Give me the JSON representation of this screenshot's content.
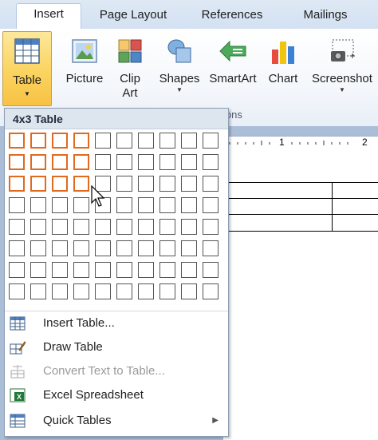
{
  "tabs": [
    {
      "label": "Insert",
      "active": true
    },
    {
      "label": "Page Layout",
      "active": false
    },
    {
      "label": "References",
      "active": false
    },
    {
      "label": "Mailings",
      "active": false
    }
  ],
  "ribbon": {
    "table_button": "Table",
    "picture_button": "Picture",
    "clipart_button_line1": "Clip",
    "clipart_button_line2": "Art",
    "shapes_button": "Shapes",
    "smartart_button": "SmartArt",
    "chart_button": "Chart",
    "screenshot_button": "Screenshot",
    "group_label_partial": "ions"
  },
  "ruler": {
    "mark1": "1",
    "mark2": "2"
  },
  "dropdown": {
    "title": "4x3 Table",
    "grid": {
      "columns": 10,
      "rows": 8,
      "selected_columns": 4,
      "selected_rows": 3
    },
    "items": [
      {
        "label": "Insert Table...",
        "icon": "insert-table-icon",
        "enabled": true,
        "submenu": false
      },
      {
        "label": "Draw Table",
        "icon": "draw-table-icon",
        "enabled": true,
        "submenu": false
      },
      {
        "label": "Convert Text to Table...",
        "icon": "convert-text-icon",
        "enabled": false,
        "submenu": false
      },
      {
        "label": "Excel Spreadsheet",
        "icon": "excel-icon",
        "enabled": true,
        "submenu": false
      },
      {
        "label": "Quick Tables",
        "icon": "quick-tables-icon",
        "enabled": true,
        "submenu": true
      }
    ]
  },
  "colors": {
    "selection_border": "#e06a1f",
    "button_highlight": "#fbd35f",
    "tab_bar": "#d3e1f2",
    "doc_background": "#aabed8"
  }
}
